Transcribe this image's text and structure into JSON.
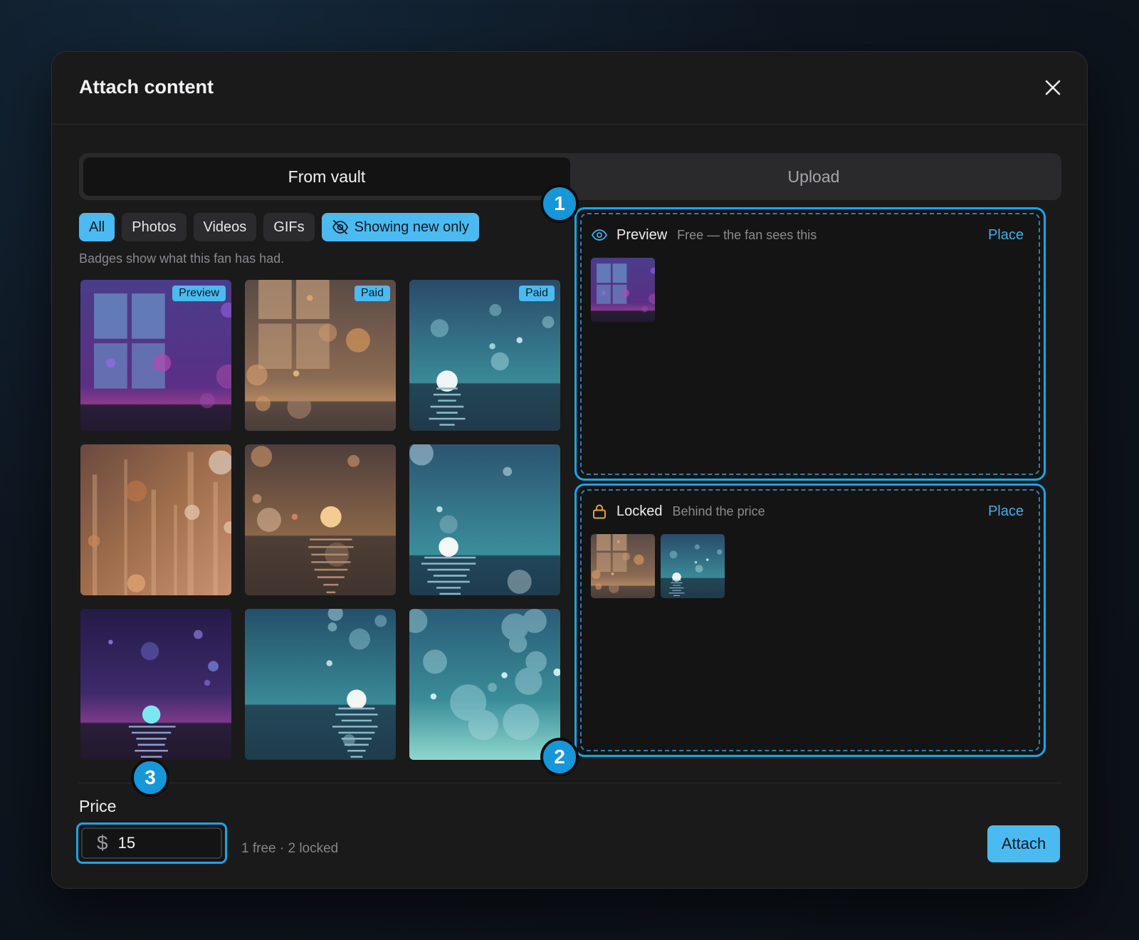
{
  "modal": {
    "title": "Attach content"
  },
  "tabs": [
    {
      "label": "From vault",
      "active": true
    },
    {
      "label": "Upload",
      "active": false
    }
  ],
  "filters": {
    "chips": [
      "All",
      "Photos",
      "Videos",
      "GIFs"
    ],
    "selected": "All",
    "toggle_label": "Showing new only",
    "toggle_on": true
  },
  "hint": "Badges show what this fan has had.",
  "vault_items": [
    {
      "scene": "purple-window",
      "badge": "Preview"
    },
    {
      "scene": "amber-window",
      "badge": "Paid"
    },
    {
      "scene": "teal-sea-moon",
      "badge": "Paid"
    },
    {
      "scene": "amber-streaks",
      "badge": ""
    },
    {
      "scene": "amber-sea-sun",
      "badge": ""
    },
    {
      "scene": "teal-sea-moon-2",
      "badge": ""
    },
    {
      "scene": "purple-sea-moon",
      "badge": ""
    },
    {
      "scene": "teal-sea-moon-3",
      "badge": ""
    },
    {
      "scene": "teal-bokeh",
      "badge": ""
    }
  ],
  "preview_zone": {
    "title": "Preview",
    "subtitle": "Free — the fan sees this",
    "action": "Place",
    "icon": "eye-icon",
    "items": [
      "purple-window"
    ]
  },
  "locked_zone": {
    "title": "Locked",
    "subtitle": "Behind the price",
    "action": "Place",
    "icon": "lock-icon",
    "items": [
      "amber-window",
      "teal-sea-moon"
    ]
  },
  "steps": [
    "1",
    "2",
    "3"
  ],
  "price": {
    "label": "Price",
    "currency": "$",
    "value": "15"
  },
  "summary": "1 free · 2 locked",
  "attach_label": "Attach",
  "colors": {
    "accent": "#4bbaf0",
    "zone_border": "#17a6e8",
    "lock": "#e9a83a"
  }
}
